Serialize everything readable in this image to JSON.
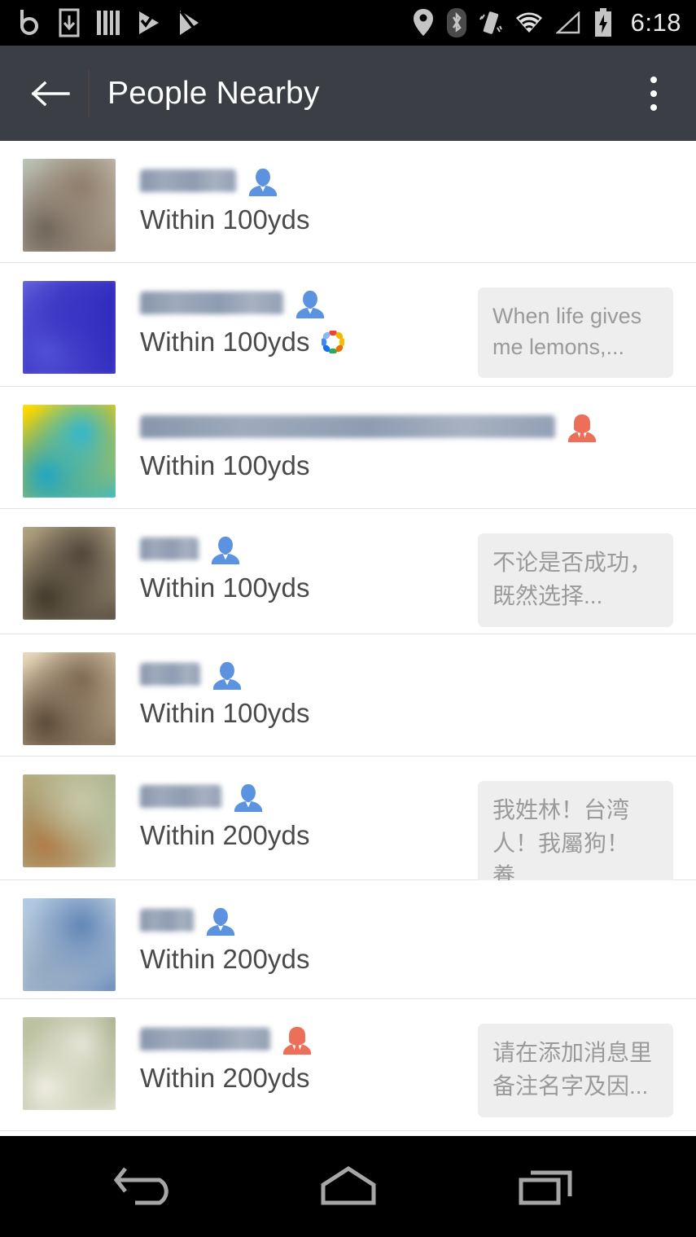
{
  "status_bar": {
    "time": "6:18",
    "left_icons": [
      "b-logo-icon",
      "download-icon",
      "barcode-icon",
      "checkmark-play-icon",
      "play-store-icon"
    ],
    "right_icons": [
      "location-pin-icon",
      "bluetooth-icon",
      "vibrate-icon",
      "wifi-icon",
      "cell-signal-icon",
      "battery-charging-icon"
    ]
  },
  "appbar": {
    "back_icon": "back-arrow-icon",
    "title": "People Nearby",
    "overflow_icon": "overflow-menu-icon"
  },
  "list": {
    "items": [
      {
        "name": "",
        "name_blur_width": 118,
        "gender": "male",
        "distance": "Within 100yds",
        "badge": null,
        "signature": null,
        "avatar_colors": [
          "#b2bdb1",
          "#8c7a68",
          "#c9c1b3",
          "#6d6257"
        ]
      },
      {
        "name": "",
        "name_blur_width": 176,
        "gender": "male",
        "distance": "Within 100yds",
        "badge": "google-photos-icon",
        "signature": "When life gives me lemons,...",
        "signature_lang": "en",
        "avatar_colors": [
          "#6b6ae0",
          "#3a35c4",
          "#2a22b8",
          "#5452d6"
        ]
      },
      {
        "name": "",
        "name_blur_width": 510,
        "gender": "female",
        "distance": "Within 100yds",
        "badge": null,
        "signature": null,
        "avatar_colors": [
          "#ffdd00",
          "#29b6d8",
          "#f2c200",
          "#1aa5c9"
        ]
      },
      {
        "name": "",
        "name_blur_width": 72,
        "gender": "male",
        "distance": "Within 100yds",
        "badge": null,
        "signature": "不论是否成功，既然选择...",
        "signature_lang": "cjk",
        "avatar_colors": [
          "#a79876",
          "#4a4035",
          "#c2b294",
          "#3d3528"
        ]
      },
      {
        "name": "",
        "name_blur_width": 74,
        "gender": "male",
        "distance": "Within 100yds",
        "badge": null,
        "signature": null,
        "avatar_colors": [
          "#e7d9bd",
          "#7a6550",
          "#d8c7a6",
          "#584636"
        ]
      },
      {
        "name": "",
        "name_blur_width": 100,
        "gender": "male",
        "distance": "Within 200yds",
        "badge": null,
        "signature": "我姓林！台湾人！我屬狗！養...",
        "signature_lang": "cjk",
        "avatar_colors": [
          "#b9a878",
          "#c8c9a8",
          "#9fae8b",
          "#b07a46"
        ]
      },
      {
        "name": "",
        "name_blur_width": 66,
        "gender": "male",
        "distance": "Within 200yds",
        "badge": null,
        "signature": null,
        "avatar_colors": [
          "#a9c4e2",
          "#5d82b4",
          "#cfd9e4",
          "#8fa7c0"
        ]
      },
      {
        "name": "",
        "name_blur_width": 160,
        "gender": "female",
        "distance": "Within 200yds",
        "badge": null,
        "signature": "请在添加消息里备注名字及因...",
        "signature_lang": "cjk",
        "avatar_colors": [
          "#c9cbb0",
          "#e9e7dc",
          "#8f9c6a",
          "#f2f0e6"
        ]
      }
    ]
  },
  "nav_bar": {
    "back_label": "back-nav-icon",
    "home_label": "home-nav-icon",
    "recents_label": "recents-nav-icon"
  },
  "colors": {
    "appbar_bg": "#3b3f45",
    "male": "#5b93e0",
    "female": "#ec7059",
    "bubble_bg": "#eeeeee",
    "bubble_text": "#9a9a9a",
    "distance_text": "#4a4a4a"
  }
}
